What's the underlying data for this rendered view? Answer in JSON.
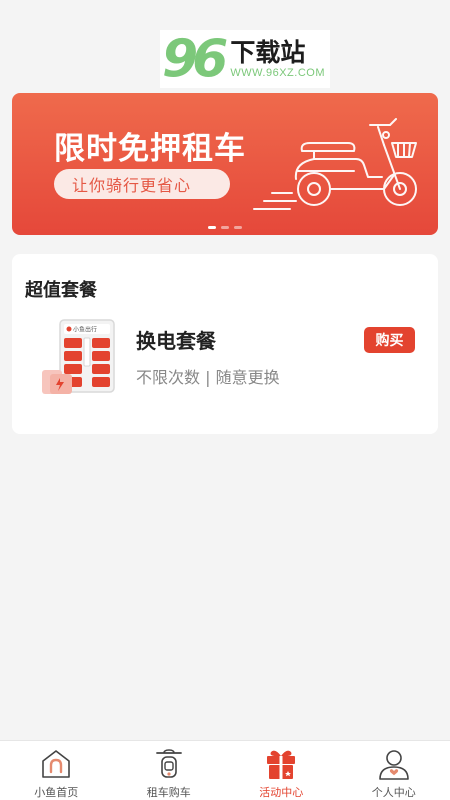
{
  "watermark": {
    "number": "96",
    "text": "下载站",
    "url": "WWW.96XZ.COM"
  },
  "banner": {
    "title": "限时免押租车",
    "subtitle": "让你骑行更省心",
    "dots": 3,
    "active_dot": 0
  },
  "card": {
    "title": "超值套餐",
    "package": {
      "name": "换电套餐",
      "description": "不限次数 | 随意更换",
      "buy_label": "购买",
      "image_label": "小鱼出行"
    }
  },
  "tabbar": {
    "items": [
      {
        "label": "小鱼首页",
        "icon": "home-icon",
        "active": false
      },
      {
        "label": "租车购车",
        "icon": "scooter-icon",
        "active": false
      },
      {
        "label": "活动中心",
        "icon": "gift-icon",
        "active": true
      },
      {
        "label": "个人中心",
        "icon": "user-icon",
        "active": false
      }
    ]
  },
  "colors": {
    "accent": "#e3432f",
    "banner_top": "#ef6a4c",
    "watermark_green": "#7cc87a"
  }
}
